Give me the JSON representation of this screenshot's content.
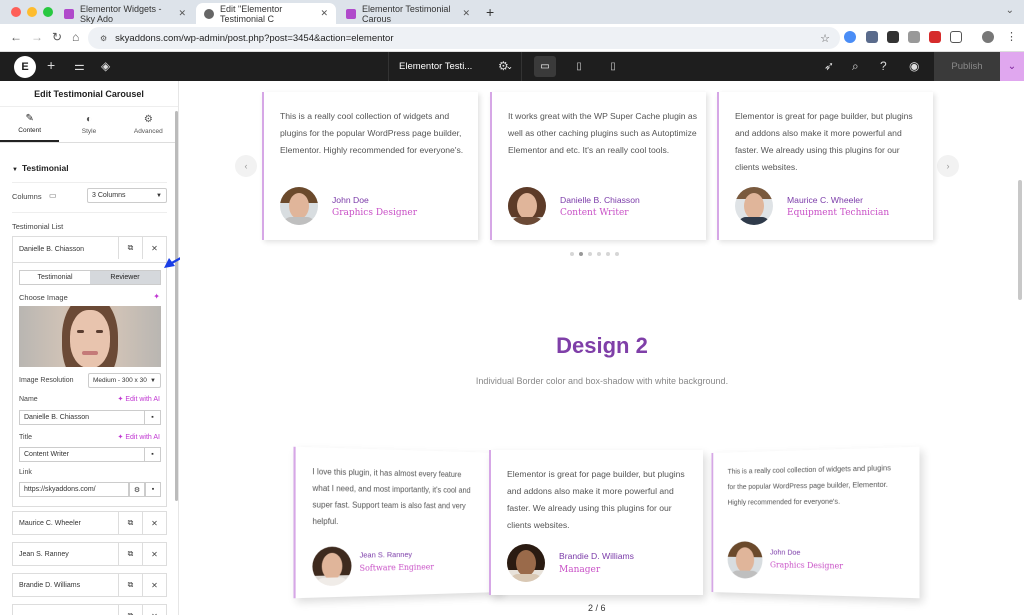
{
  "browser": {
    "tabs": [
      {
        "label": "Elementor Widgets - Sky Ado"
      },
      {
        "label": "Edit \"Elementor Testimonial C"
      },
      {
        "label": "Elementor Testimonial Carous"
      }
    ],
    "url": "skyaddons.com/wp-admin/post.php?post=3454&action=elementor"
  },
  "topbar": {
    "doc_title": "Elementor Testi...",
    "publish": "Publish"
  },
  "panel": {
    "title": "Edit Testimonial Carousel",
    "tabs": [
      "Content",
      "Style",
      "Advanced"
    ],
    "section": "Testimonial",
    "columns_label": "Columns",
    "columns_value": "3 Columns",
    "list_label": "Testimonial List",
    "open_item": "Danielle B. Chiasson",
    "seg": [
      "Testimonial",
      "Reviewer"
    ],
    "choose_image": "Choose Image",
    "image_resolution_label": "Image Resolution",
    "image_resolution_value": "Medium - 300 x 30",
    "name_label": "Name",
    "name_value": "Danielle B. Chiasson",
    "title_label": "Title",
    "title_value": "Content Writer",
    "link_label": "Link",
    "link_value": "https://skyaddons.com/",
    "edit_ai": "Edit with AI",
    "items": [
      "Maurice C. Wheeler",
      "Jean S. Ranney",
      "Brandie D. Williams"
    ]
  },
  "design1": {
    "cards": [
      {
        "text": "This is a really cool collection of widgets and plugins for the popular WordPress page builder, Elementor. Highly recommended for everyone's.",
        "name": "John Doe",
        "title": "Graphics Designer"
      },
      {
        "text": "It works great with the WP Super Cache plugin as well as other caching plugins such as Autoptimize Elementor and etc. It's an really cool tools.",
        "name": "Danielle B. Chiasson",
        "title": "Content Writer"
      },
      {
        "text": "Elementor is great for page builder, but plugins and addons also make it more powerful and faster. We already using this plugins for our clients websites.",
        "name": "Maurice C. Wheeler",
        "title": "Equipment Technician"
      }
    ]
  },
  "design2": {
    "heading": "Design 2",
    "subheading": "Individual Border color and box-shadow with white background.",
    "cards": [
      {
        "text": "I love this plugin, it has almost every feature what I need, and most importantly, it's cool and super fast. Support team is also fast and very helpful.",
        "name": "Jean S. Ranney",
        "title": "Software Engineer"
      },
      {
        "text": "Elementor is great for page builder, but plugins and addons also make it more powerful and faster. We already using this plugins for our clients websites.",
        "name": "Brandie D. Williams",
        "title": "Manager"
      },
      {
        "text": "This is a really cool collection of widgets and plugins for the popular WordPress page builder, Elementor. Highly recommended for everyone's.",
        "name": "John Doe",
        "title": "Graphics Designer"
      }
    ],
    "pagination": "2 / 6"
  }
}
